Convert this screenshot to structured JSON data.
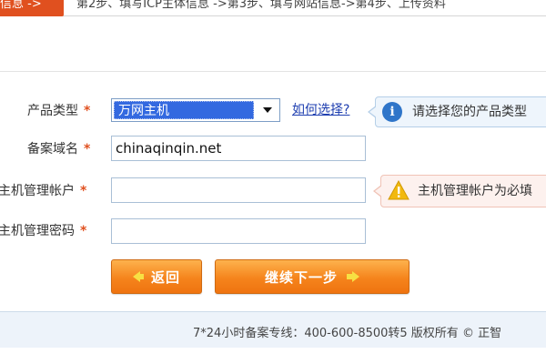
{
  "steps": {
    "current": "信息 ->",
    "rest": "第2步、填写ICP主体信息 ->第3步、填写网站信息->第4步、上传资料"
  },
  "form": {
    "product_type": {
      "label": "产品类型",
      "selected": "万网主机",
      "help_link": "如何选择?",
      "tip": "请选择您的产品类型"
    },
    "domain": {
      "label": "备案域名",
      "value": "chinaqinqin.net"
    },
    "account": {
      "label": "主机管理帐户",
      "value": "",
      "warning": "主机管理帐户为必填"
    },
    "password": {
      "label": "主机管理密码",
      "value": ""
    },
    "required_mark": "*"
  },
  "buttons": {
    "back": "返回",
    "next": "继续下一步"
  },
  "footer": {
    "text": "7*24小时备案专线：400-600-8500转5 版权所有 © 正智"
  },
  "colors": {
    "accent": "#e0501f",
    "button": "#f5841c",
    "info": "#2f75c9",
    "warning": "#f2b90f"
  },
  "icons": {
    "tip": "info-icon",
    "warning": "warning-icon",
    "dropdown": "chevron-down-icon"
  }
}
